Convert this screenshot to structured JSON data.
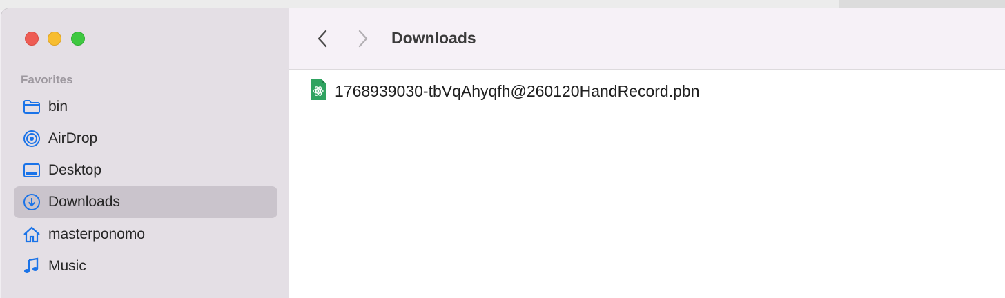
{
  "window": {
    "title": "Downloads"
  },
  "sidebar": {
    "section_title": "Favorites",
    "items": [
      {
        "label": "bin",
        "icon": "folder-icon"
      },
      {
        "label": "AirDrop",
        "icon": "airdrop-icon"
      },
      {
        "label": "Desktop",
        "icon": "desktop-icon"
      },
      {
        "label": "Downloads",
        "icon": "download-icon",
        "selected": true
      },
      {
        "label": "masterponomo",
        "icon": "home-icon"
      },
      {
        "label": "Music",
        "icon": "music-note-icon"
      }
    ]
  },
  "files": [
    {
      "name": "1768939030-tbVqAhyqfh@260120HandRecord.pbn",
      "icon": "atom-file-icon"
    }
  ],
  "colors": {
    "accent": "#1a73e8",
    "selected_bg": "#cac4cc",
    "sidebar_bg": "#e4dfe5",
    "file_icon": "#2fa360"
  }
}
